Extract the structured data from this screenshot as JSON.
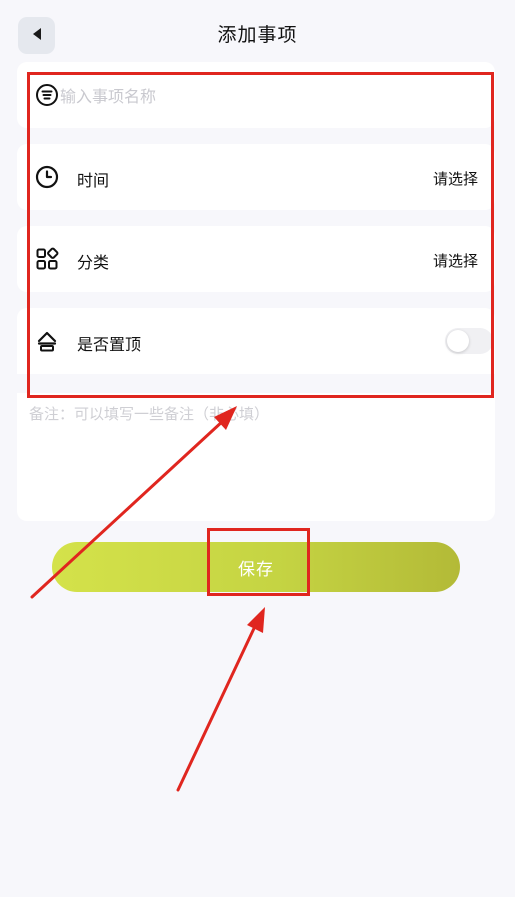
{
  "header": {
    "title": "添加事项",
    "back_icon": "back-arrow-icon"
  },
  "form": {
    "name": {
      "placeholder": "输入事项名称",
      "value": ""
    },
    "time": {
      "label": "时间",
      "value": "请选择"
    },
    "category": {
      "label": "分类",
      "value": "请选择"
    },
    "pin": {
      "label": "是否置顶",
      "on": false
    },
    "notes": {
      "placeholder": "备注：可以填写一些备注（非必填）",
      "value": ""
    }
  },
  "save_button": {
    "label": "保存"
  },
  "colors": {
    "background": "#f7f7fb",
    "save_gradient_start": "#d4e24a",
    "save_gradient_end": "#b3ba37",
    "annotation": "#e0261f"
  }
}
